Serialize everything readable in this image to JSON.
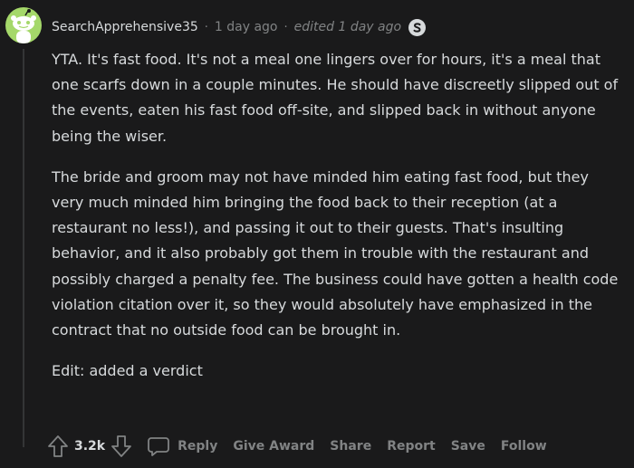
{
  "comment": {
    "username": "SearchApprehensive35",
    "separator": "·",
    "timestamp": "1 day ago",
    "edited": "edited 1 day ago",
    "avatar_color": "#a5d86a",
    "paragraphs": [
      "YTA. It's fast food. It's not a meal one lingers over for hours, it's a meal that one scarfs down in a couple minutes. He should have discreetly slipped out of the events, eaten his fast food off-site, and slipped back in without anyone being the wiser.",
      "The bride and groom may not have minded him eating fast food, but they very much minded him bringing the food back to their reception (at a restaurant no less!), and passing it out to their guests. That's insulting behavior, and it also probably got them in trouble with the restaurant and possibly charged a penalty fee. The business could have gotten a health code violation citation over it, so they would absolutely have emphasized in the contract that no outside food can be brought in.",
      "Edit: added a verdict"
    ]
  },
  "actions": {
    "vote_count": "3.2k",
    "reply": "Reply",
    "give_award": "Give Award",
    "share": "Share",
    "report": "Report",
    "save": "Save",
    "follow": "Follow"
  },
  "colors": {
    "background": "#1a1a1b",
    "text": "#d7dadc",
    "muted": "#818384"
  }
}
